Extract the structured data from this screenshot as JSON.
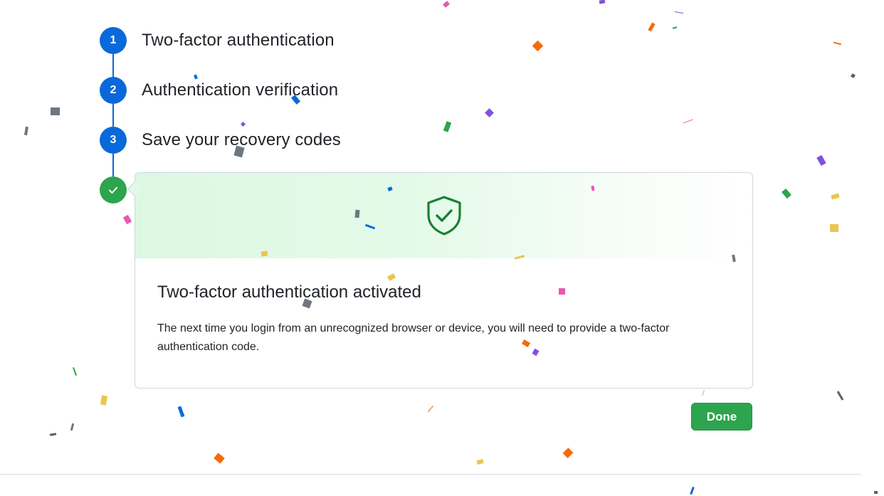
{
  "steps": [
    {
      "number": "1",
      "title": "Two-factor authentication"
    },
    {
      "number": "2",
      "title": "Authentication verification"
    },
    {
      "number": "3",
      "title": "Save your recovery codes"
    }
  ],
  "final_step": {
    "icon": "check-icon"
  },
  "card": {
    "banner_icon": "shield-check-icon",
    "heading": "Two-factor authentication activated",
    "description": "The next time you login from an unrecognized browser or device, you will need to provide a two-factor authentication code."
  },
  "actions": {
    "done_label": "Done"
  },
  "colors": {
    "step_blue": "#0969da",
    "success_green": "#2da44e",
    "shield_green": "#1a7f37",
    "banner_green": "#dcf8e2"
  }
}
